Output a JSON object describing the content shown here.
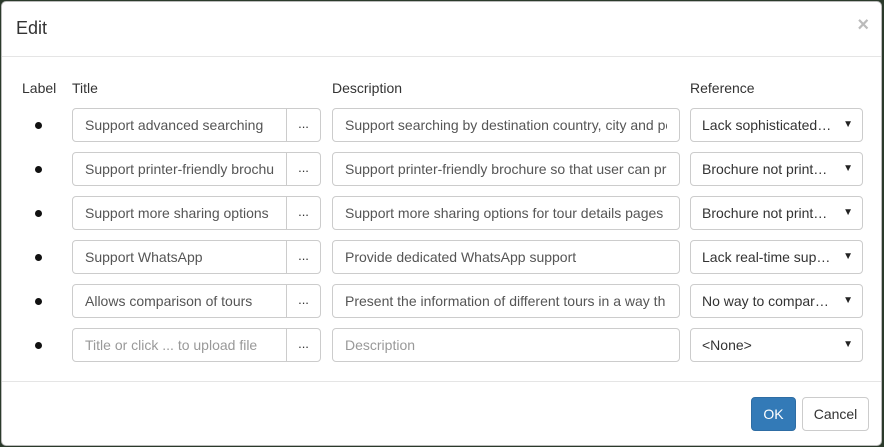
{
  "dialog": {
    "title": "Edit",
    "close_glyph": "×"
  },
  "columns": {
    "label": "Label",
    "title": "Title",
    "description": "Description",
    "reference": "Reference"
  },
  "rows": [
    {
      "title": "Support advanced searching",
      "description": "Support searching by destination country, city and pe",
      "reference": "Lack sophisticated ..."
    },
    {
      "title": "Support printer-friendly brochu",
      "description": "Support printer-friendly brochure so that user can pr",
      "reference": "Brochure not printa..."
    },
    {
      "title": "Support more sharing options",
      "description": "Support more sharing options for tour details pages",
      "reference": "Brochure not printa..."
    },
    {
      "title": "Support WhatsApp",
      "description": "Provide dedicated WhatsApp support",
      "reference": "Lack real-time supp..."
    },
    {
      "title": "Allows comparison of tours",
      "description": "Present the information of different tours in a way th",
      "reference": "No way to compare ..."
    },
    {
      "title": "",
      "description": "",
      "reference": "<None>"
    }
  ],
  "new_row": {
    "title_placeholder": "Title or click ... to upload file",
    "description_placeholder": "Description"
  },
  "dots_label": "...",
  "footer": {
    "ok_label": "OK",
    "cancel_label": "Cancel"
  },
  "colors": {
    "primary": "#337ab7",
    "border": "#cccccc"
  }
}
